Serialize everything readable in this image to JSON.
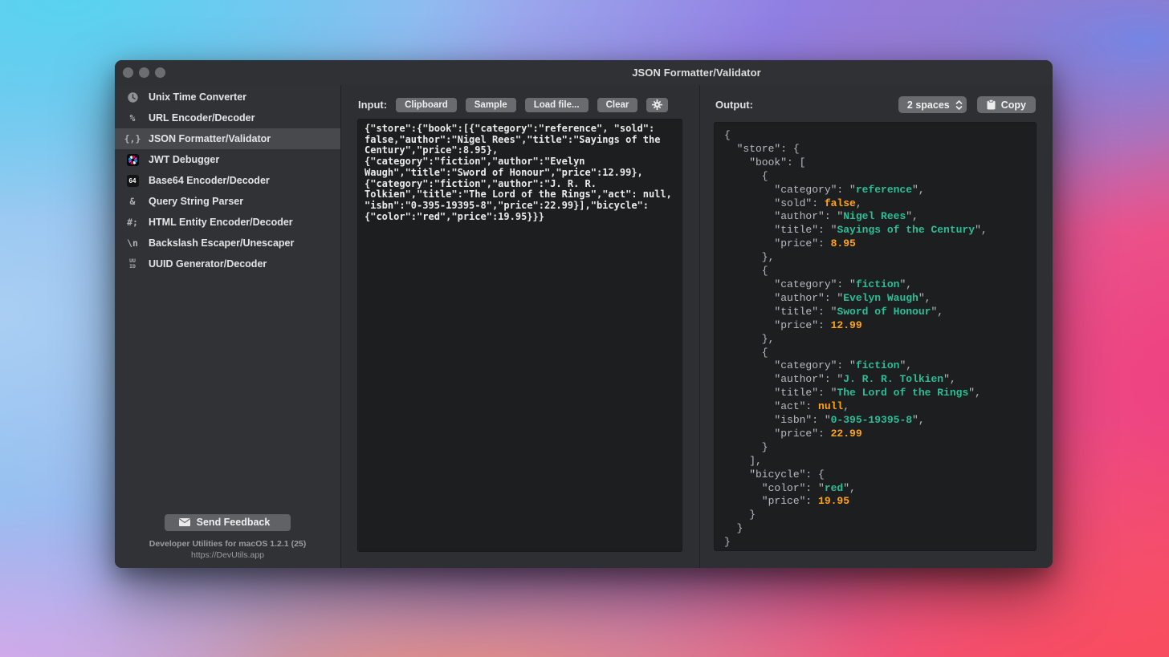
{
  "titlebar": {
    "title": "JSON Formatter/Validator"
  },
  "window_controls": [
    "close",
    "minimize",
    "zoom"
  ],
  "colors": {
    "tok_plain": "#b7bcbf",
    "tok_string": "#2dbd97",
    "tok_number": "#ffa417",
    "selected_row": "#48494d",
    "panel_bg": "#2e2f32",
    "editor_bg": "#1d1e20"
  },
  "sidebar": {
    "items": [
      {
        "icon": "clock-icon",
        "label": "Unix Time Converter"
      },
      {
        "icon": "percent-icon",
        "label": "URL Encoder/Decoder",
        "glyph": "%"
      },
      {
        "icon": "braces-icon",
        "label": "JSON Formatter/Validator",
        "glyph": "{,}",
        "selected": true
      },
      {
        "icon": "jwt-icon",
        "label": "JWT Debugger"
      },
      {
        "icon": "base64-icon",
        "label": "Base64 Encoder/Decoder",
        "glyph": "64"
      },
      {
        "icon": "ampersand-icon",
        "label": "Query String Parser",
        "glyph": "&"
      },
      {
        "icon": "hash-semicolon-icon",
        "label": "HTML Entity Encoder/Decoder",
        "glyph": "#;"
      },
      {
        "icon": "backslash-n-icon",
        "label": "Backslash Escaper/Unescaper",
        "glyph": "\\n"
      },
      {
        "icon": "uuid-icon",
        "label": "UUID Generator/Decoder",
        "glyph": "UU\nID"
      }
    ],
    "feedback_button": "Send Feedback",
    "version_line1": "Developer Utilities for macOS 1.2.1 (25)",
    "version_line2": "https://DevUtils.app"
  },
  "input": {
    "label": "Input:",
    "buttons": [
      "Clipboard",
      "Sample",
      "Load file...",
      "Clear"
    ],
    "gear_button": "settings",
    "lines": [
      "{\"store\":{\"book\":[{\"category\":\"reference\", \"sold\":",
      "false,\"author\":\"Nigel Rees\",\"title\":\"Sayings of the",
      "Century\",\"price\":8.95},",
      "{\"category\":\"fiction\",\"author\":\"Evelyn",
      "Waugh\",\"title\":\"Sword of Honour\",\"price\":12.99},",
      "{\"category\":\"fiction\",\"author\":\"J. R. R.",
      "Tolkien\",\"title\":\"The Lord of the Rings\",\"act\": null,",
      "\"isbn\":\"0-395-19395-8\",\"price\":22.99}],\"bicycle\":",
      "{\"color\":\"red\",\"price\":19.95}}}"
    ]
  },
  "output": {
    "label": "Output:",
    "indent_select": "2 spaces",
    "copy_label": "Copy",
    "lines": [
      [
        [
          "p",
          "{"
        ]
      ],
      [
        [
          "p",
          "  \"store\": {"
        ]
      ],
      [
        [
          "p",
          "    \"book\": ["
        ]
      ],
      [
        [
          "p",
          "      {"
        ]
      ],
      [
        [
          "p",
          "        \"category\": \""
        ],
        [
          "s",
          "reference"
        ],
        [
          "p",
          "\","
        ]
      ],
      [
        [
          "p",
          "        \"sold\": "
        ],
        [
          "n",
          "false"
        ],
        [
          "p",
          ","
        ]
      ],
      [
        [
          "p",
          "        \"author\": \""
        ],
        [
          "s",
          "Nigel Rees"
        ],
        [
          "p",
          "\","
        ]
      ],
      [
        [
          "p",
          "        \"title\": \""
        ],
        [
          "s",
          "Sayings of the Century"
        ],
        [
          "p",
          "\","
        ]
      ],
      [
        [
          "p",
          "        \"price\": "
        ],
        [
          "n",
          "8.95"
        ]
      ],
      [
        [
          "p",
          "      },"
        ]
      ],
      [
        [
          "p",
          "      {"
        ]
      ],
      [
        [
          "p",
          "        \"category\": \""
        ],
        [
          "s",
          "fiction"
        ],
        [
          "p",
          "\","
        ]
      ],
      [
        [
          "p",
          "        \"author\": \""
        ],
        [
          "s",
          "Evelyn Waugh"
        ],
        [
          "p",
          "\","
        ]
      ],
      [
        [
          "p",
          "        \"title\": \""
        ],
        [
          "s",
          "Sword of Honour"
        ],
        [
          "p",
          "\","
        ]
      ],
      [
        [
          "p",
          "        \"price\": "
        ],
        [
          "n",
          "12.99"
        ]
      ],
      [
        [
          "p",
          "      },"
        ]
      ],
      [
        [
          "p",
          "      {"
        ]
      ],
      [
        [
          "p",
          "        \"category\": \""
        ],
        [
          "s",
          "fiction"
        ],
        [
          "p",
          "\","
        ]
      ],
      [
        [
          "p",
          "        \"author\": \""
        ],
        [
          "s",
          "J. R. R. Tolkien"
        ],
        [
          "p",
          "\","
        ]
      ],
      [
        [
          "p",
          "        \"title\": \""
        ],
        [
          "s",
          "The Lord of the Rings"
        ],
        [
          "p",
          "\","
        ]
      ],
      [
        [
          "p",
          "        \"act\": "
        ],
        [
          "n",
          "null"
        ],
        [
          "p",
          ","
        ]
      ],
      [
        [
          "p",
          "        \"isbn\": \""
        ],
        [
          "s",
          "0-395-19395-8"
        ],
        [
          "p",
          "\","
        ]
      ],
      [
        [
          "p",
          "        \"price\": "
        ],
        [
          "n",
          "22.99"
        ]
      ],
      [
        [
          "p",
          "      }"
        ]
      ],
      [
        [
          "p",
          "    ],"
        ]
      ],
      [
        [
          "p",
          "    \"bicycle\": {"
        ]
      ],
      [
        [
          "p",
          "      \"color\": \""
        ],
        [
          "s",
          "red"
        ],
        [
          "p",
          "\","
        ]
      ],
      [
        [
          "p",
          "      \"price\": "
        ],
        [
          "n",
          "19.95"
        ]
      ],
      [
        [
          "p",
          "    }"
        ]
      ],
      [
        [
          "p",
          "  }"
        ]
      ],
      [
        [
          "p",
          "}"
        ]
      ]
    ]
  }
}
